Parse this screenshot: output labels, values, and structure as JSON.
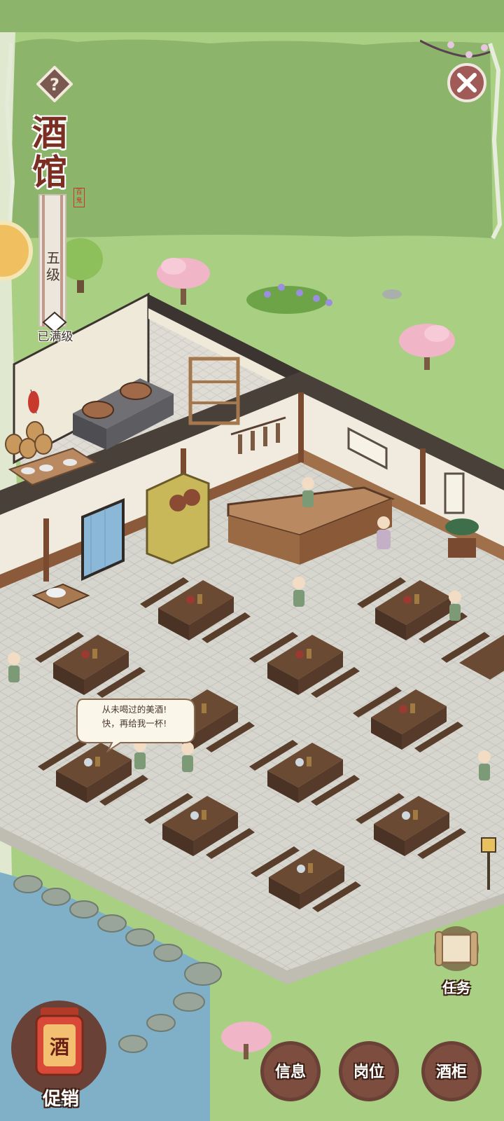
{
  "panel": {
    "title_chars": [
      "酒",
      "馆"
    ],
    "seal": "百鬼",
    "level": "五级",
    "level_status": "已满级",
    "help_icon": "question-mark-icon",
    "close_icon": "close-x-icon"
  },
  "scene": {
    "speech_bubble": {
      "line1": "从未喝过的美酒!",
      "line2": "快，再给我一杯!"
    }
  },
  "buttons": {
    "task": "任务",
    "promo": "促销",
    "promo_sign": "酒",
    "info": "信息",
    "position": "岗位",
    "wine_cabinet": "酒柜"
  },
  "colors": {
    "grass": "#a8cf82",
    "panel_bg": "#8cb46a",
    "floor": "#d4d4cc",
    "wall": "#efe9da",
    "wood": "#6b4a34",
    "title_red": "#7a2f22",
    "button_bg": "#6a4136"
  }
}
